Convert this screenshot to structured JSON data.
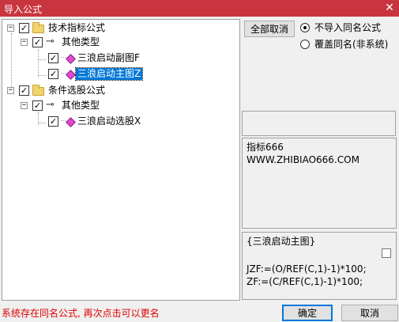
{
  "window": {
    "title": "导入公式",
    "close_glyph": "✕"
  },
  "tree": {
    "groups": [
      {
        "label": "技术指标公式",
        "expand": "−",
        "checked": "✓",
        "sub": {
          "label": "其他类型",
          "expand": "−",
          "checked": "✓",
          "items": [
            {
              "label": "三浪启动副图F",
              "checked": "✓",
              "selected": false
            },
            {
              "label": "三浪启动主图Z",
              "checked": "✓",
              "selected": true
            }
          ]
        }
      },
      {
        "label": "条件选股公式",
        "expand": "−",
        "checked": "✓",
        "sub": {
          "label": "其他类型",
          "expand": "−",
          "checked": "✓",
          "items": [
            {
              "label": "三浪启动选股X",
              "checked": "✓",
              "selected": false
            }
          ]
        }
      }
    ]
  },
  "buttons": {
    "cancel_all": "全部取消",
    "confirm": "确定",
    "cancel": "取消"
  },
  "options": {
    "selected": 0,
    "items": [
      "不导入同名公式",
      "覆盖同名(非系统)"
    ]
  },
  "info": {
    "line1": "指标666",
    "line2": "WWW.ZHIBIAO666.COM"
  },
  "code": {
    "title": "{三浪启动主图}",
    "lines": [
      "JZF:=(O/REF(C,1)-1)*100;",
      "ZF:=(C/REF(C,1)-1)*100;"
    ]
  },
  "status": "系统存在同名公式, 再次点击可以更名"
}
